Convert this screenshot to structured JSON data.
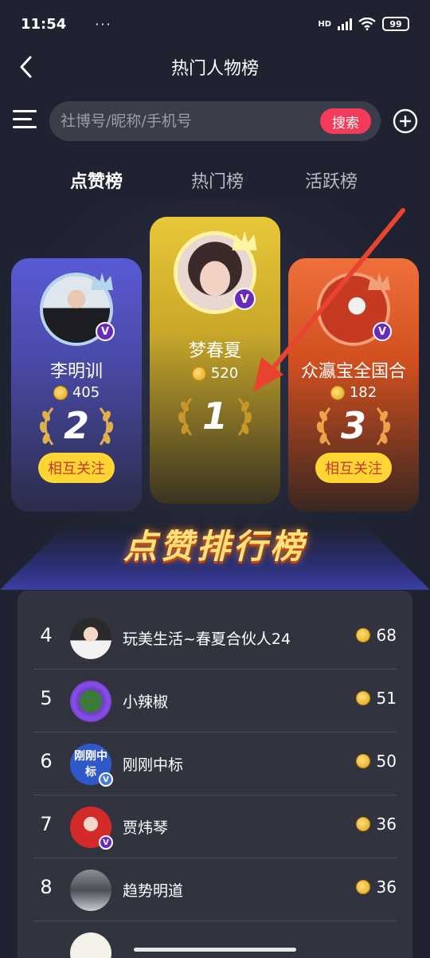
{
  "status_bar": {
    "time": "11:54",
    "more": "···",
    "battery": "99",
    "network_label": "HD"
  },
  "nav": {
    "title": "热门人物榜",
    "back_icon": "chevron-left-icon"
  },
  "search": {
    "placeholder": "社博号/昵称/手机号",
    "button_label": "搜索",
    "menu_icon": "menu-icon",
    "add_icon": "plus-circle-icon"
  },
  "tabs": [
    {
      "label": "点赞榜",
      "active": true
    },
    {
      "label": "热门榜",
      "active": false
    },
    {
      "label": "活跃榜",
      "active": false
    }
  ],
  "podium": {
    "first": {
      "rank": "1",
      "name": "梦春夏",
      "likes": "520"
    },
    "second": {
      "rank": "2",
      "name": "李明训",
      "likes": "405",
      "follow_label": "相互关注"
    },
    "third": {
      "rank": "3",
      "name": "众瀛宝全国合",
      "likes": "182",
      "follow_label": "相互关注"
    }
  },
  "banner": {
    "title": "点赞排行榜"
  },
  "ranking": [
    {
      "rank": "4",
      "name": "玩美生活~春夏合伙人24",
      "likes": "68"
    },
    {
      "rank": "5",
      "name": "小辣椒",
      "likes": "51"
    },
    {
      "rank": "6",
      "name": "刚刚中标",
      "likes": "50",
      "avatar_text": "刚刚中标"
    },
    {
      "rank": "7",
      "name": "贾炜琴",
      "likes": "36"
    },
    {
      "rank": "8",
      "name": "趋势明道",
      "likes": "36"
    },
    {
      "rank": "",
      "name": "",
      "likes": ""
    }
  ],
  "colors": {
    "background": "#1f2230",
    "search_button": "#f53b5c",
    "follow_button": "#ffd534",
    "card_gold": "#e8c838",
    "card_blue": "#5a5ad6",
    "card_orange": "#f0703c",
    "annotation_arrow": "#e8442f"
  }
}
